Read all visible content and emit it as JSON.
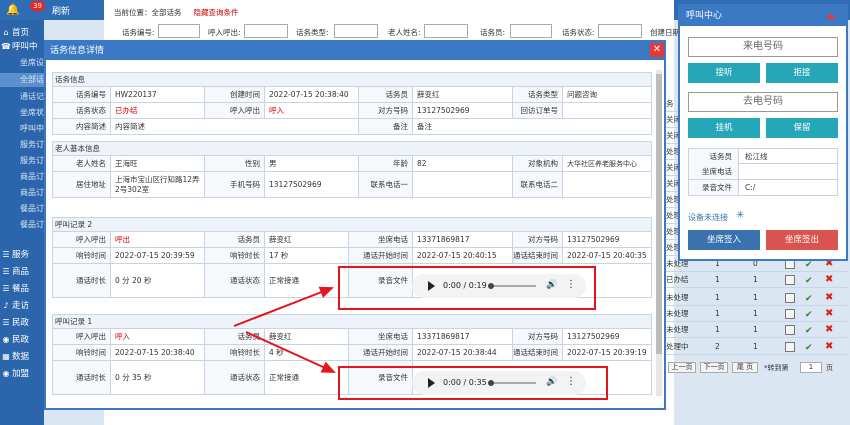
{
  "topbar": {
    "badge": "39",
    "refresh": "刷新"
  },
  "sidebar": {
    "items": [
      {
        "icon": "home-icon",
        "glyph": "⌂",
        "label": "首页"
      },
      {
        "icon": "phone-icon",
        "glyph": "☎",
        "label": "呼叫中"
      },
      {
        "label": "坐席设"
      },
      {
        "label": "全部话"
      },
      {
        "label": "通话记"
      },
      {
        "label": "坐席状"
      },
      {
        "label": "呼叫中"
      },
      {
        "label": "服务订"
      },
      {
        "label": "服务订"
      },
      {
        "label": "商品订"
      },
      {
        "label": "商品订"
      },
      {
        "label": "餐品订"
      },
      {
        "label": "餐品订"
      },
      {
        "icon": "service-icon",
        "glyph": "☰",
        "label": "服务"
      },
      {
        "icon": "goods-icon",
        "glyph": "☰",
        "label": "商品"
      },
      {
        "icon": "food-icon",
        "glyph": "☰",
        "label": "餐品"
      },
      {
        "icon": "visit-icon",
        "glyph": "♪",
        "label": "走访"
      },
      {
        "icon": "civil-icon",
        "glyph": "☰",
        "label": "民政"
      },
      {
        "icon": "civil2-icon",
        "glyph": "◉",
        "label": "民政"
      },
      {
        "icon": "data-icon",
        "glyph": "▦",
        "label": "数据"
      },
      {
        "icon": "join-icon",
        "glyph": "◉",
        "label": "加盟"
      }
    ]
  },
  "page": {
    "breadcrumb_prefix": "当前位置：",
    "breadcrumb_current": "全部话务",
    "breadcrumb_link": "隐藏查询条件",
    "filters": [
      "话务编号:",
      "呼入呼出:",
      "话务类型:",
      "老人姓名:",
      "话务员:",
      "话务状态:",
      "创建日期"
    ],
    "right_rows": [
      {
        "a": "务"
      },
      {
        "a": "关闭"
      },
      {
        "a": "关闭"
      },
      {
        "a": "处理"
      },
      {
        "a": "关闭"
      },
      {
        "a": "关闭"
      },
      {
        "a": "处理"
      },
      {
        "a": "处理"
      },
      {
        "a": "处理"
      },
      {
        "a": "处理"
      },
      {
        "a": "处理中"
      },
      {
        "a": "未处理",
        "b": "1",
        "c": "0"
      },
      {
        "a": "已办结",
        "b": "1",
        "c": "1"
      },
      {
        "a": "未处理",
        "b": "1",
        "c": "1"
      },
      {
        "a": "未处理",
        "b": "1",
        "c": "1"
      },
      {
        "a": "未处理",
        "b": "1",
        "c": "1"
      },
      {
        "a": "处理中",
        "b": "2",
        "c": "1"
      }
    ],
    "pager": {
      "prev": "上一页",
      "next": "下一页",
      "last": "尾 页",
      "goto": "*转到第",
      "page": "1",
      "page_suffix": "页"
    }
  },
  "dialog": {
    "title": "话务信息详情",
    "sec_info": "话务信息",
    "info": {
      "l_no": "话务编号",
      "no": "HW220137",
      "l_created": "创建时间",
      "created": "2022-07-15 20:38:40",
      "l_op": "话务员",
      "op": "薛变红",
      "l_type": "话务类型",
      "type": "问题咨询",
      "l_status": "话务状态",
      "status": "已办结",
      "l_dir": "呼入呼出",
      "dir": "呼入",
      "l_peer": "对方号码",
      "peer": "13127502969",
      "l_order": "回访订单号",
      "order": "",
      "l_desc": "内容简述",
      "desc": "内容简述",
      "l_note": "备注",
      "note": "备注"
    },
    "sec_elder": "老人基本信息",
    "elder": {
      "l_name": "老人姓名",
      "name": "王海旺",
      "l_sex": "性别",
      "sex": "男",
      "l_age": "年龄",
      "age": "82",
      "l_org": "对象机构",
      "org": "大华社区养老服务中心",
      "l_addr": "居住地址",
      "addr": "上海市宝山区行知路12弄2号302室",
      "l_phone": "手机号码",
      "phone": "13127502969",
      "l_c1": "联系电话一",
      "c1": "",
      "l_c2": "联系电话二",
      "c2": ""
    },
    "records": [
      {
        "title": "呼叫记录 2",
        "l_dir": "呼入呼出",
        "dir": "呼出",
        "l_op": "话务员",
        "op": "薛变红",
        "l_seat": "坐席电话",
        "seat": "13371869817",
        "l_peer": "对方号码",
        "peer": "13127502969",
        "l_ring": "响铃时间",
        "ring": "2022-07-15 20:39:59",
        "l_ringlen": "响铃时长",
        "ringlen": "17 秒",
        "l_start": "通话开始时间",
        "start": "2022-07-15 20:40:15",
        "l_end": "通话结束时间",
        "end": "2022-07-15 20:40:35",
        "l_dur": "通话时长",
        "dur": "0 分 20 秒",
        "l_state": "通话状态",
        "state": "正常接通",
        "l_rec": "录音文件",
        "audio": "0:00 / 0:19"
      },
      {
        "title": "呼叫记录 1",
        "l_dir": "呼入呼出",
        "dir": "呼入",
        "l_op": "话务员",
        "op": "薛变红",
        "l_seat": "坐席电话",
        "seat": "13371869817",
        "l_peer": "对方号码",
        "peer": "13127502969",
        "l_ring": "响铃时间",
        "ring": "2022-07-15 20:38:40",
        "l_ringlen": "响铃时长",
        "ringlen": "4 秒",
        "l_start": "通话开始时间",
        "start": "2022-07-15 20:38:44",
        "l_end": "通话结束时间",
        "end": "2022-07-15 20:39:19",
        "l_dur": "通话时长",
        "dur": "0 分 35 秒",
        "l_state": "通话状态",
        "state": "正常接通",
        "l_rec": "录音文件",
        "audio": "0:00 / 0:35"
      }
    ]
  },
  "callcenter": {
    "title": "呼叫中心",
    "incoming_placeholder": "来电号码",
    "answer": "接听",
    "reject": "拒接",
    "outgoing_placeholder": "去电号码",
    "hangup": "挂机",
    "hold": "保留",
    "l_op": "话务员",
    "op": "松江线",
    "l_seat": "坐席电话",
    "seat": "",
    "l_rec": "录音文件",
    "rec": "C:/",
    "device": "设备未连接",
    "signin": "坐席签入",
    "signout": "坐席签出",
    "colors": {
      "teal": "#25a7b7",
      "blue": "#3a72b0",
      "red": "#d9534f"
    }
  }
}
